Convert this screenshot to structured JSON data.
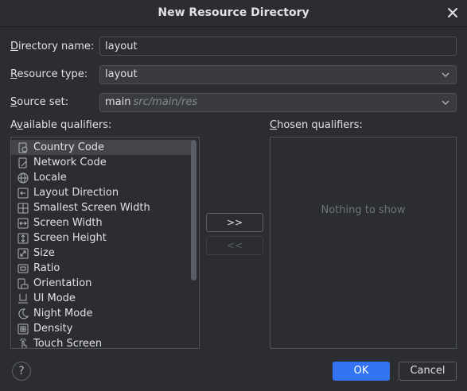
{
  "dialog": {
    "title": "New Resource Directory",
    "close_icon": "close-icon"
  },
  "form": {
    "directory_name": {
      "label_mnemonic": "D",
      "label_rest": "irectory name:",
      "value": "layout"
    },
    "resource_type": {
      "label_mnemonic": "R",
      "label_rest": "esource type:",
      "value": "layout"
    },
    "source_set": {
      "label_mnemonic": "S",
      "label_rest": "ource set:",
      "value": "main",
      "hint": "src/main/res"
    }
  },
  "available": {
    "label_pre": "A",
    "label_mnemonic": "v",
    "label_rest": "ailable qualifiers:",
    "items": [
      {
        "label": "Country Code",
        "icon": "country-code-icon"
      },
      {
        "label": "Network Code",
        "icon": "network-code-icon"
      },
      {
        "label": "Locale",
        "icon": "globe-icon"
      },
      {
        "label": "Layout Direction",
        "icon": "layout-direction-icon"
      },
      {
        "label": "Smallest Screen Width",
        "icon": "smallest-width-icon"
      },
      {
        "label": "Screen Width",
        "icon": "screen-width-icon"
      },
      {
        "label": "Screen Height",
        "icon": "screen-height-icon"
      },
      {
        "label": "Size",
        "icon": "size-icon"
      },
      {
        "label": "Ratio",
        "icon": "ratio-icon"
      },
      {
        "label": "Orientation",
        "icon": "orientation-icon"
      },
      {
        "label": "UI Mode",
        "icon": "ui-mode-icon"
      },
      {
        "label": "Night Mode",
        "icon": "moon-icon"
      },
      {
        "label": "Density",
        "icon": "density-icon"
      },
      {
        "label": "Touch Screen",
        "icon": "touch-icon"
      }
    ]
  },
  "chosen": {
    "label_mnemonic": "C",
    "label_rest": "hosen qualifiers:",
    "empty_text": "Nothing to show"
  },
  "buttons": {
    "add": ">>",
    "remove": "<<",
    "help": "?",
    "ok": "OK",
    "cancel": "Cancel"
  }
}
